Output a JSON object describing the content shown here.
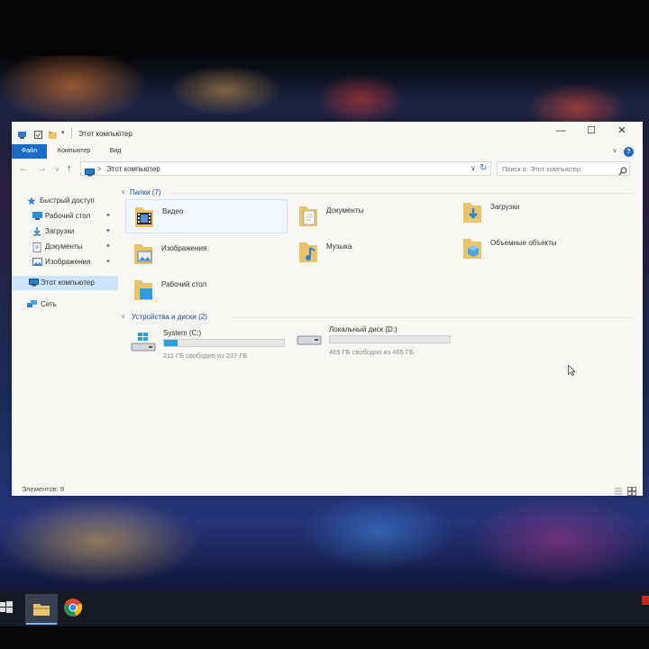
{
  "window": {
    "title": "Этот компьютер",
    "controls": {
      "minimize": "—",
      "maximize": "☐",
      "close": "✕"
    }
  },
  "ribbon": {
    "tabs": [
      "Файл",
      "Компьютер",
      "Вид"
    ],
    "help": "?"
  },
  "address": {
    "back": "←",
    "forward": "→",
    "recent": "∨",
    "up": "↑",
    "separator": ">",
    "path": "Этот компьютер",
    "search_placeholder": "Поиск в: Этот компьютер"
  },
  "nav_pane": {
    "items": [
      {
        "label": "Быстрый доступ",
        "icon": "star-icon",
        "pinned": false
      },
      {
        "label": "Рабочий стол",
        "icon": "desktop-icon",
        "pinned": true
      },
      {
        "label": "Загрузки",
        "icon": "download-icon",
        "pinned": true
      },
      {
        "label": "Документы",
        "icon": "document-icon",
        "pinned": true
      },
      {
        "label": "Изображения",
        "icon": "pictures-icon",
        "pinned": true
      },
      {
        "label": "Этот компьютер",
        "icon": "computer-icon",
        "pinned": false
      },
      {
        "label": "Сеть",
        "icon": "network-icon",
        "pinned": false
      }
    ],
    "pin_glyph": "✦"
  },
  "folders_group": {
    "header": "Папки (7)",
    "items": [
      {
        "label": "Видео",
        "icon": "video-folder-icon"
      },
      {
        "label": "Документы",
        "icon": "documents-folder-icon"
      },
      {
        "label": "Загрузки",
        "icon": "downloads-folder-icon"
      },
      {
        "label": "Изображения",
        "icon": "pictures-folder-icon"
      },
      {
        "label": "Музыка",
        "icon": "music-folder-icon"
      },
      {
        "label": "Объемные объекты",
        "icon": "3d-objects-folder-icon"
      },
      {
        "label": "Рабочий стол",
        "icon": "desktop-folder-icon"
      }
    ]
  },
  "drives_group": {
    "header": "Устройства и диски (2)",
    "items": [
      {
        "label": "System (C:)",
        "free": "211 ГБ свободно из 237 ГБ",
        "used_fraction": 0.11,
        "icon": "system-drive-icon"
      },
      {
        "label": "Локальный диск (D:)",
        "free": "465 ГБ свободно из 465 ГБ",
        "used_fraction": 0.0,
        "icon": "local-drive-icon"
      }
    ]
  },
  "status": {
    "items_count": "Элементов: 9"
  },
  "colors": {
    "accent": "#1d69c7",
    "bar_fill": "#26a0da",
    "selection": "#cce3f8"
  }
}
